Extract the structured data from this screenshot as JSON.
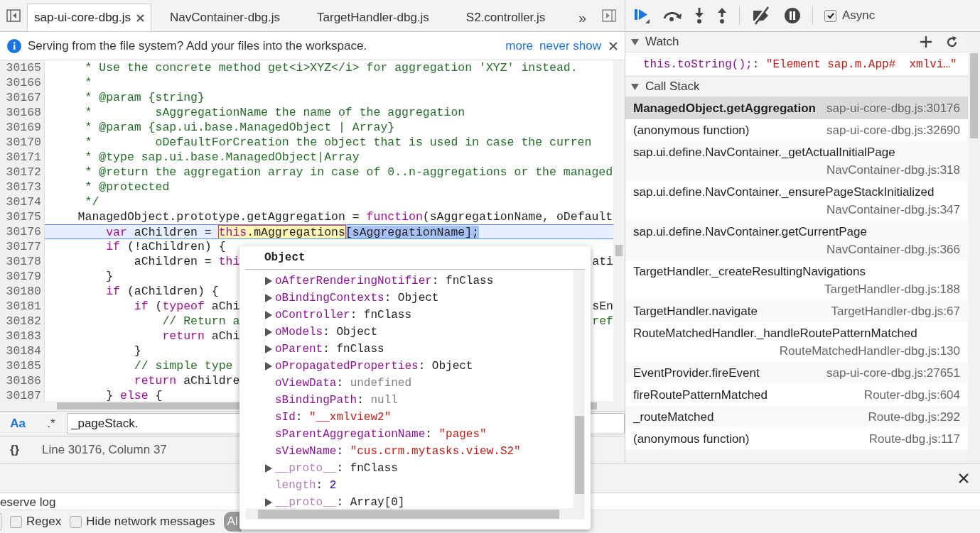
{
  "tabs": [
    {
      "label": "sap-ui-core-dbg.js",
      "selected": true
    },
    {
      "label": "NavContainer-dbg.js",
      "selected": false
    },
    {
      "label": "TargetHandler-dbg.js",
      "selected": false
    },
    {
      "label": "S2.controller.js",
      "selected": false
    }
  ],
  "tabs_overflow": "»",
  "infobar": {
    "message": "Serving from the file system? Add your files into the workspace.",
    "links": [
      "more",
      "never show"
    ]
  },
  "code": [
    {
      "number": "30165",
      "current": false,
      "segments": [
        {
          "kind": "comment",
          "text": "     * Use the concrete method get<i>XYZ</i> for aggregation 'XYZ' instead."
        }
      ]
    },
    {
      "number": "30166",
      "current": false,
      "segments": [
        {
          "kind": "comment",
          "text": "     *"
        }
      ]
    },
    {
      "number": "30167",
      "current": false,
      "segments": [
        {
          "kind": "comment",
          "text": "     * @param {string}"
        }
      ]
    },
    {
      "number": "30168",
      "current": false,
      "segments": [
        {
          "kind": "comment",
          "text": "     *         sAggregationName the name of the aggregation"
        }
      ]
    },
    {
      "number": "30169",
      "current": false,
      "segments": [
        {
          "kind": "comment",
          "text": "     * @param {sap.ui.base.ManagedObject | Array}"
        }
      ]
    },
    {
      "number": "30170",
      "current": false,
      "segments": [
        {
          "kind": "comment",
          "text": "     *         oDefaultForCreation the object that is used in case the curren"
        }
      ]
    },
    {
      "number": "30171",
      "current": false,
      "segments": [
        {
          "kind": "comment",
          "text": "     * @type sap.ui.base.ManagedObject|Array"
        }
      ]
    },
    {
      "number": "30172",
      "current": false,
      "segments": [
        {
          "kind": "comment",
          "text": "     * @return the aggregation array in case of 0..n-aggregations or the managed"
        }
      ]
    },
    {
      "number": "30173",
      "current": false,
      "segments": [
        {
          "kind": "comment",
          "text": "     * @protected"
        }
      ]
    },
    {
      "number": "30174",
      "current": false,
      "segments": [
        {
          "kind": "comment",
          "text": "     */"
        }
      ]
    },
    {
      "number": "30175",
      "current": false,
      "segments": [
        {
          "kind": "plain",
          "text": "    ManagedObject.prototype.getAggregation = "
        },
        {
          "kind": "keyword",
          "text": "function"
        },
        {
          "kind": "plain",
          "text": "(sAggregationName, oDefault"
        }
      ]
    },
    {
      "number": "30176",
      "current": true,
      "segments": [
        {
          "kind": "keyword",
          "text": "        var"
        },
        {
          "kind": "plain",
          "text": " aChildren = "
        },
        {
          "kind": "hover",
          "segments": [
            {
              "kind": "keyword",
              "text": "this"
            },
            {
              "kind": "plain",
              "text": ".mAggregations"
            }
          ]
        },
        {
          "kind": "selection",
          "segments": [
            {
              "kind": "plain",
              "text": "[sAggregationName];"
            }
          ]
        }
      ]
    },
    {
      "number": "30177",
      "current": false,
      "segments": [
        {
          "kind": "keyword",
          "text": "        if"
        },
        {
          "kind": "plain",
          "text": " (!aChildren) {"
        }
      ]
    },
    {
      "number": "30178",
      "current": false,
      "segments": [
        {
          "kind": "plain",
          "text": "            aChildren = "
        },
        {
          "kind": "keyword",
          "text": "thi"
        }
      ],
      "tail": {
        "kind": "plain",
        "text": "ati"
      }
    },
    {
      "number": "30179",
      "current": false,
      "segments": [
        {
          "kind": "plain",
          "text": "        }"
        }
      ]
    },
    {
      "number": "30180",
      "current": false,
      "segments": [
        {
          "kind": "keyword",
          "text": "        if"
        },
        {
          "kind": "plain",
          "text": " (aChildren) {"
        }
      ]
    },
    {
      "number": "30181",
      "current": false,
      "segments": [
        {
          "kind": "keyword",
          "text": "            if"
        },
        {
          "kind": "plain",
          "text": " ("
        },
        {
          "kind": "keyword",
          "text": "typeof"
        },
        {
          "kind": "plain",
          "text": " aChi"
        }
      ],
      "tail": {
        "kind": "plain",
        "text": "sEn"
      }
    },
    {
      "number": "30182",
      "current": false,
      "segments": [
        {
          "kind": "comment",
          "text": "                // Return a"
        }
      ],
      "tail": {
        "kind": "comment",
        "text": "ref"
      }
    },
    {
      "number": "30183",
      "current": false,
      "segments": [
        {
          "kind": "keyword",
          "text": "                return"
        },
        {
          "kind": "plain",
          "text": " aChi"
        }
      ]
    },
    {
      "number": "30184",
      "current": false,
      "segments": [
        {
          "kind": "plain",
          "text": "            }"
        }
      ]
    },
    {
      "number": "30185",
      "current": false,
      "segments": [
        {
          "kind": "comment",
          "text": "            // simple type"
        }
      ]
    },
    {
      "number": "30186",
      "current": false,
      "segments": [
        {
          "kind": "keyword",
          "text": "            return"
        },
        {
          "kind": "plain",
          "text": " aChildre"
        }
      ]
    },
    {
      "number": "30187",
      "current": false,
      "segments": [
        {
          "kind": "plain",
          "text": "        } "
        },
        {
          "kind": "keyword",
          "text": "else"
        },
        {
          "kind": "plain",
          "text": " {"
        }
      ]
    }
  ],
  "search": {
    "match_case": {
      "label": "Aa",
      "on": true
    },
    "regex": {
      "label": ".*",
      "on": false
    },
    "value": "_pageStack."
  },
  "status": {
    "format_label": "{}",
    "position": "Line 30176, Column 37"
  },
  "popup": {
    "title": "Object",
    "tree": [
      {
        "children": [
          {
            "name": "oAfterRenderingNotifier",
            "separator": ":",
            "value": "fnClass",
            "kind": "object",
            "expandable": true,
            "dimmed": false
          },
          {
            "name": "oBindingContexts",
            "separator": ":",
            "value": "Object",
            "kind": "object",
            "expandable": true,
            "dimmed": false
          },
          {
            "name": "oController",
            "separator": ":",
            "value": "fnClass",
            "kind": "object",
            "expandable": true,
            "dimmed": false
          },
          {
            "name": "oModels",
            "separator": ":",
            "value": "Object",
            "kind": "object",
            "expandable": true,
            "dimmed": false
          },
          {
            "name": "oParent",
            "separator": ":",
            "value": "fnClass",
            "kind": "object",
            "expandable": true,
            "dimmed": false
          },
          {
            "name": "oPropagatedProperties",
            "separator": ":",
            "value": "Object",
            "kind": "object",
            "expandable": true,
            "dimmed": false
          },
          {
            "name": "oViewData",
            "separator": ":",
            "value": "undefined",
            "kind": "empty",
            "expandable": false,
            "dimmed": false
          },
          {
            "name": "sBindingPath",
            "separator": ":",
            "value": "null",
            "kind": "empty",
            "expandable": false,
            "dimmed": false
          },
          {
            "name": "sId",
            "separator": ":",
            "value": "\"__xmlview2\"",
            "kind": "string",
            "expandable": false,
            "dimmed": false
          },
          {
            "name": "sParentAggregationName",
            "separator": ":",
            "value": "\"pages\"",
            "kind": "string",
            "expandable": false,
            "dimmed": false
          },
          {
            "name": "sViewName",
            "separator": ":",
            "value": "\"cus.crm.mytasks.view.S2\"",
            "kind": "string",
            "expandable": false,
            "dimmed": false
          },
          {
            "name": "__proto__",
            "separator": ":",
            "value": "fnClass",
            "kind": "object",
            "expandable": true,
            "dimmed": true
          }
        ]
      },
      {
        "name": "length",
        "separator": ":",
        "value": "2",
        "kind": "number",
        "expandable": false,
        "dimmed": true
      },
      {
        "name": "__proto__",
        "separator": ":",
        "value": "Array[0]",
        "kind": "object",
        "expandable": true,
        "dimmed": true
      }
    ]
  },
  "debugger": {
    "async": {
      "label": "Async",
      "checked": true
    },
    "watch": {
      "title": "Watch",
      "expanded": true,
      "expressions": [
        {
          "expression": "this.toString();",
          "separator": ":",
          "value": "\"Element sap.m.App#  xmlvi…\""
        }
      ]
    },
    "call_stack": {
      "title": "Call Stack",
      "expanded": true,
      "frames": [
        {
          "function": "ManagedObject.getAggregation",
          "location": "sap-ui-core-dbg.js:30176",
          "selected": true
        },
        {
          "function": "(anonymous function)",
          "location": "sap-ui-core-dbg.js:32690",
          "selected": false
        },
        {
          "function": "sap.ui.define.NavContainer._getActualInitialPage",
          "location": "NavContainer-dbg.js:318",
          "selected": false
        },
        {
          "function": "sap.ui.define.NavContainer._ensurePageStackInitialized",
          "location": "NavContainer-dbg.js:347",
          "selected": false
        },
        {
          "function": "sap.ui.define.NavContainer.getCurrentPage",
          "location": "NavContainer-dbg.js:366",
          "selected": false
        },
        {
          "function": "TargetHandler._createResultingNavigations",
          "location": "TargetHandler-dbg.js:188",
          "selected": false
        },
        {
          "function": "TargetHandler.navigate",
          "location": "TargetHandler-dbg.js:67",
          "selected": false
        },
        {
          "function": "RouteMatchedHandler._handleRoutePatternMatched",
          "location": "RouteMatchedHandler-dbg.js:130",
          "selected": false
        },
        {
          "function": "EventProvider.fireEvent",
          "location": "sap-ui-core-dbg.js:27651",
          "selected": false
        },
        {
          "function": "fireRoutePatternMatched",
          "location": "Router-dbg.js:604",
          "selected": false
        },
        {
          "function": "_routeMatched",
          "location": "Route-dbg.js:292",
          "selected": false
        },
        {
          "function": "(anonymous function)",
          "location": "Route-dbg.js:117",
          "selected": false
        }
      ]
    }
  },
  "console": {
    "partial_option": "eserve log",
    "filters": [
      {
        "label": "Regex",
        "checked": false
      },
      {
        "label": "Hide network messages",
        "checked": false
      }
    ],
    "level_button": "Al"
  }
}
